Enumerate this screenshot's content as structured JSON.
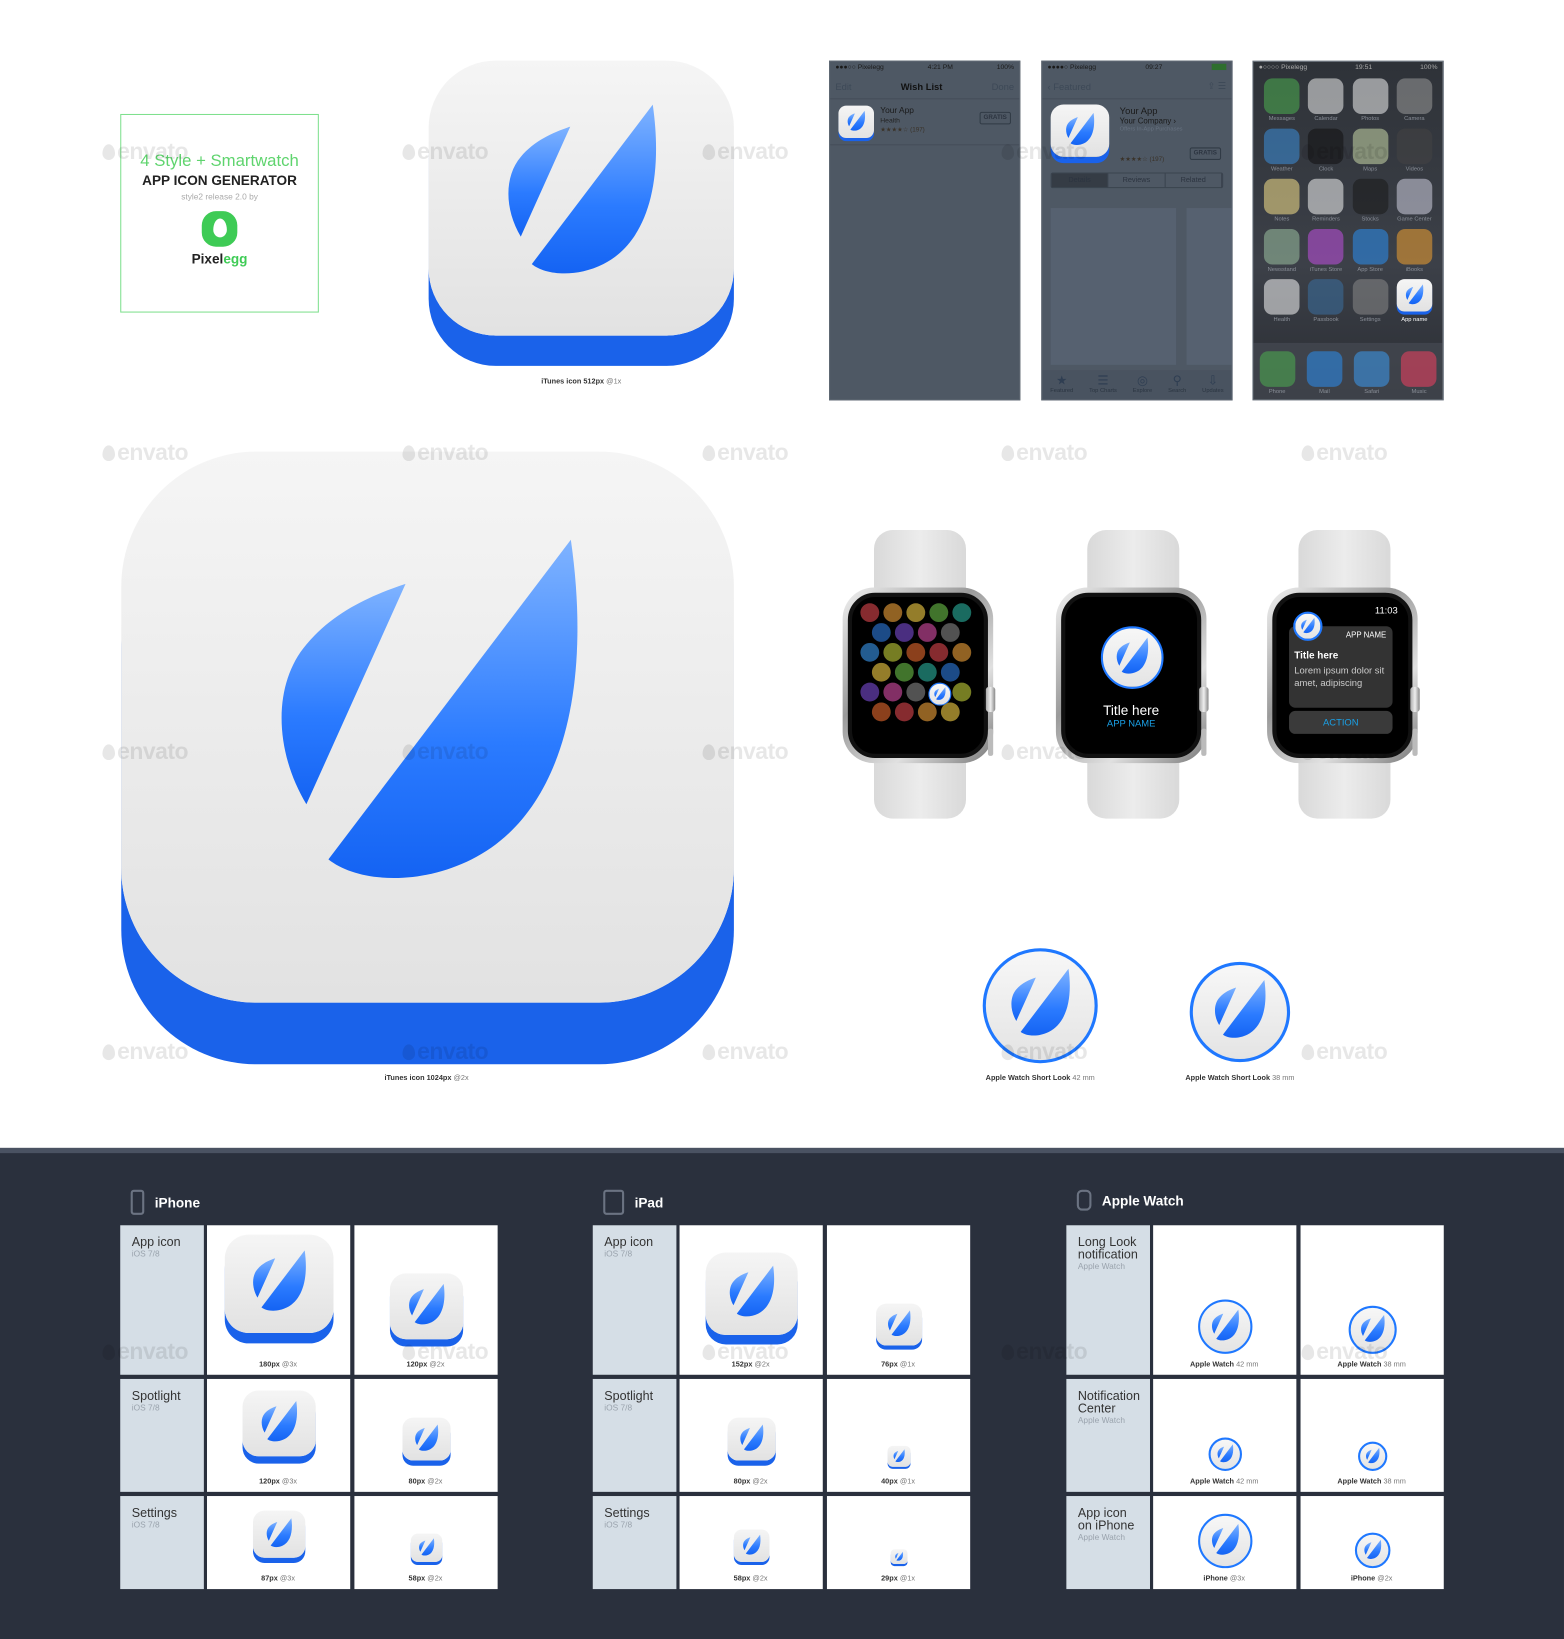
{
  "watermark": "envato",
  "promo": {
    "line1": "4 Style + Smartwatch",
    "line2": "APP ICON GENERATOR",
    "line3": "style2 release 2.0 by",
    "brand_a": "Pixel",
    "brand_b": "egg"
  },
  "colors": {
    "accent": "#1f6cf5",
    "dark_bg": "#2a303d",
    "label_bg": "#d5dee6",
    "promo_green": "#3ecb55"
  },
  "captions": {
    "itunes512": {
      "bold": "iTunes icon 512px",
      "rest": "@1x"
    },
    "itunes1024": {
      "bold": "iTunes icon 1024px",
      "rest": "@2x"
    },
    "short42": {
      "bold": "Apple Watch Short Look",
      "rest": "42 mm"
    },
    "short38": {
      "bold": "Apple Watch Short Look",
      "rest": "38 mm"
    }
  },
  "wishlist": {
    "status": {
      "carrier": "●●●○○ Pixelegg",
      "time": "4:21 PM",
      "battery": "100%"
    },
    "nav": {
      "left": "Edit",
      "title": "Wish List",
      "right": "Done"
    },
    "item": {
      "name": "Your App",
      "category": "Health",
      "rating": "★★★★☆ (197)",
      "price": "GRATIS"
    }
  },
  "appstore": {
    "status": {
      "carrier": "●●●●○ Pixelegg",
      "time": "09:27",
      "battery": ""
    },
    "nav": {
      "back": "‹ Featured"
    },
    "item": {
      "name": "Your App",
      "company": "Your Company ›",
      "note": "Offers In-App Purchases",
      "rating": "★★★★☆ (197)",
      "price": "GRATIS"
    },
    "segments": [
      "Details",
      "Reviews",
      "Related"
    ],
    "tabs": [
      {
        "icon": "★",
        "label": "Featured"
      },
      {
        "icon": "☰",
        "label": "Top Charts"
      },
      {
        "icon": "◎",
        "label": "Explore"
      },
      {
        "icon": "⚲",
        "label": "Search"
      },
      {
        "icon": "⇩",
        "label": "Updates"
      }
    ]
  },
  "homescreen": {
    "status": {
      "carrier": "●○○○○ Pixelegg",
      "time": "19:51",
      "battery": "100%"
    },
    "apps": [
      {
        "label": "Messages",
        "color": "#4caf50"
      },
      {
        "label": "Calendar",
        "color": "#eeeeee"
      },
      {
        "label": "Photos",
        "color": "#f0f0f0"
      },
      {
        "label": "Camera",
        "color": "#999999"
      },
      {
        "label": "Weather",
        "color": "#3b8ed8"
      },
      {
        "label": "Clock",
        "color": "#111111"
      },
      {
        "label": "Maps",
        "color": "#c8d8a8"
      },
      {
        "label": "Videos",
        "color": "#444444"
      },
      {
        "label": "Notes",
        "color": "#f5e08a"
      },
      {
        "label": "Reminders",
        "color": "#f4f4f4"
      },
      {
        "label": "Stocks",
        "color": "#1a1a1a"
      },
      {
        "label": "Game Center",
        "color": "#d0d0e0"
      },
      {
        "label": "Newsstand",
        "color": "#9bc0a0"
      },
      {
        "label": "iTunes Store",
        "color": "#c04ee0"
      },
      {
        "label": "App Store",
        "color": "#2a8ef0"
      },
      {
        "label": "iBooks",
        "color": "#f0a030"
      },
      {
        "label": "Health",
        "color": "#f5f5f5"
      },
      {
        "label": "Passbook",
        "color": "#3a6fa0"
      },
      {
        "label": "Settings",
        "color": "#888888"
      },
      {
        "label": "App name",
        "color": "#ffffff"
      }
    ],
    "dock": [
      {
        "label": "Phone",
        "color": "#4caf50"
      },
      {
        "label": "Mail",
        "color": "#2a8ef0"
      },
      {
        "label": "Safari",
        "color": "#3a9af0"
      },
      {
        "label": "Music",
        "color": "#f04060"
      }
    ]
  },
  "watch_glance": {
    "title": "Title here",
    "app": "APP NAME"
  },
  "watch_notification": {
    "time": "11:03",
    "app": "APP NAME",
    "title": "Title here",
    "body": "Lorem ipsum dolor sit amet, adipiscing",
    "action": "ACTION"
  },
  "specs": [
    {
      "device": "iPhone",
      "device_icon": "phone-icon",
      "shape": "square",
      "rows": [
        {
          "title": "App icon",
          "sub": "iOS 7/8",
          "cells": [
            {
              "size": "180px",
              "scale": "@3x"
            },
            {
              "size": "120px",
              "scale": "@2x"
            }
          ]
        },
        {
          "title": "Spotlight",
          "sub": "iOS 7/8",
          "cells": [
            {
              "size": "120px",
              "scale": "@3x"
            },
            {
              "size": "80px",
              "scale": "@2x"
            }
          ]
        },
        {
          "title": "Settings",
          "sub": "iOS 7/8",
          "cells": [
            {
              "size": "87px",
              "scale": "@3x"
            },
            {
              "size": "58px",
              "scale": "@2x"
            }
          ]
        }
      ]
    },
    {
      "device": "iPad",
      "device_icon": "tablet-icon",
      "shape": "square",
      "rows": [
        {
          "title": "App icon",
          "sub": "iOS 7/8",
          "cells": [
            {
              "size": "152px",
              "scale": "@2x"
            },
            {
              "size": "76px",
              "scale": "@1x"
            }
          ]
        },
        {
          "title": "Spotlight",
          "sub": "iOS 7/8",
          "cells": [
            {
              "size": "80px",
              "scale": "@2x"
            },
            {
              "size": "40px",
              "scale": "@1x"
            }
          ]
        },
        {
          "title": "Settings",
          "sub": "iOS 7/8",
          "cells": [
            {
              "size": "58px",
              "scale": "@2x"
            },
            {
              "size": "29px",
              "scale": "@1x"
            }
          ]
        }
      ]
    },
    {
      "device": "Apple Watch",
      "device_icon": "watch-icon",
      "shape": "round",
      "rows": [
        {
          "title": "Long Look notification",
          "sub": "Apple Watch",
          "cells": [
            {
              "size": "Apple Watch",
              "scale": "42 mm"
            },
            {
              "size": "Apple Watch",
              "scale": "38 mm"
            }
          ]
        },
        {
          "title": "Notification Center",
          "sub": "Apple Watch",
          "cells": [
            {
              "size": "Apple Watch",
              "scale": "42 mm"
            },
            {
              "size": "Apple Watch",
              "scale": "38 mm"
            }
          ]
        },
        {
          "title": "App icon on iPhone",
          "sub": "Apple Watch",
          "cells": [
            {
              "size": "iPhone",
              "scale": "@3x"
            },
            {
              "size": "iPhone",
              "scale": "@2x"
            }
          ]
        }
      ]
    }
  ]
}
